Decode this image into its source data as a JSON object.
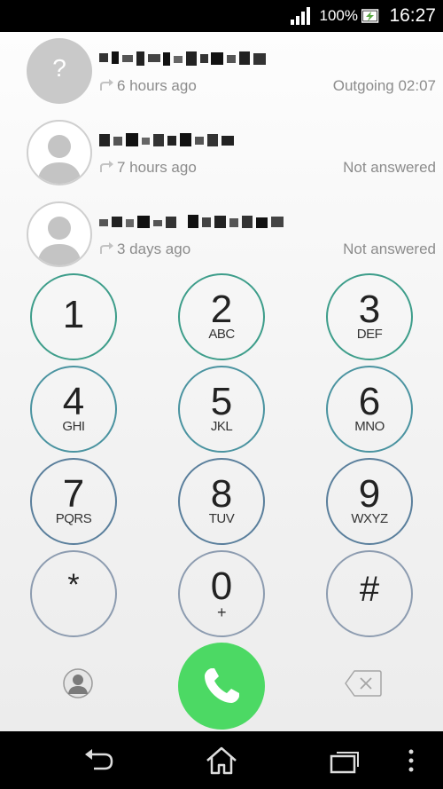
{
  "status_bar": {
    "battery_percent": "100%",
    "time": "16:27"
  },
  "call_log": [
    {
      "avatar": "unknown",
      "avatar_symbol": "?",
      "time_ago": "6 hours ago",
      "status": "Outgoing 02:07"
    },
    {
      "avatar": "person",
      "time_ago": "7 hours ago",
      "status": "Not answered"
    },
    {
      "avatar": "person",
      "time_ago": "3 days ago",
      "status": "Not answered"
    }
  ],
  "keypad": [
    {
      "digit": "1",
      "letters": ""
    },
    {
      "digit": "2",
      "letters": "ABC"
    },
    {
      "digit": "3",
      "letters": "DEF"
    },
    {
      "digit": "4",
      "letters": "GHI"
    },
    {
      "digit": "5",
      "letters": "JKL"
    },
    {
      "digit": "6",
      "letters": "MNO"
    },
    {
      "digit": "7",
      "letters": "PQRS"
    },
    {
      "digit": "8",
      "letters": "TUV"
    },
    {
      "digit": "9",
      "letters": "WXYZ"
    },
    {
      "digit": "*",
      "letters": ""
    },
    {
      "digit": "0",
      "letters": "+"
    },
    {
      "digit": "#",
      "letters": ""
    }
  ],
  "icons": {
    "signal": "signal-icon",
    "battery": "battery-charging-icon",
    "call_type": "outgoing-call-arrow-icon",
    "contacts": "contacts-icon",
    "call": "phone-icon",
    "backspace": "backspace-icon",
    "nav_back": "back-icon",
    "nav_home": "home-icon",
    "nav_recents": "recent-apps-icon",
    "nav_menu": "menu-icon"
  },
  "colors": {
    "accent": "#3d9d8a",
    "call_button": "#4cd964"
  }
}
